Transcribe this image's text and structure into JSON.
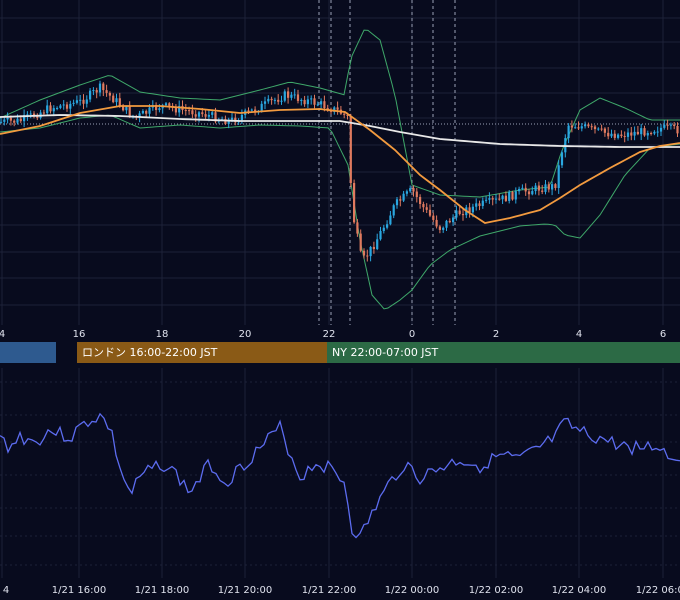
{
  "colors": {
    "background": "#080b1e",
    "grid": "#1d2238",
    "bull_candle": "#2aa7e0",
    "bear_candle": "#e07a5f",
    "bollinger": "#3fa86a",
    "ma_short": "#f29a3f",
    "ma_long": "#e8e8e8",
    "oscillator": "#5c6cf0",
    "session_tokyo": "#2e5a8f",
    "session_london": "#8a5a16",
    "session_ny": "#2c6a45"
  },
  "sessions": [
    {
      "id": "tokyo",
      "label": ""
    },
    {
      "id": "london",
      "label": "ロンドン 16:00-22:00 JST"
    },
    {
      "id": "ny",
      "label": "NY 22:00-07:00 JST"
    }
  ],
  "chart_data": [
    {
      "type": "candlestick",
      "panel": "price",
      "x_tick_labels": [
        "4",
        "16",
        "18",
        "20",
        "22",
        "0",
        "2",
        "4",
        "6"
      ],
      "indicators": [
        "bollinger-bands",
        "moving-average-short",
        "moving-average-long"
      ],
      "grid": true
    },
    {
      "type": "line",
      "panel": "oscillator",
      "x_tick_labels": [
        "4",
        "1/21 16:00",
        "1/21 18:00",
        "1/21 20:00",
        "1/21 22:00",
        "1/22 00:00",
        "1/22 02:00",
        "1/22 04:00",
        "1/22 06:00"
      ],
      "grid": true
    }
  ]
}
